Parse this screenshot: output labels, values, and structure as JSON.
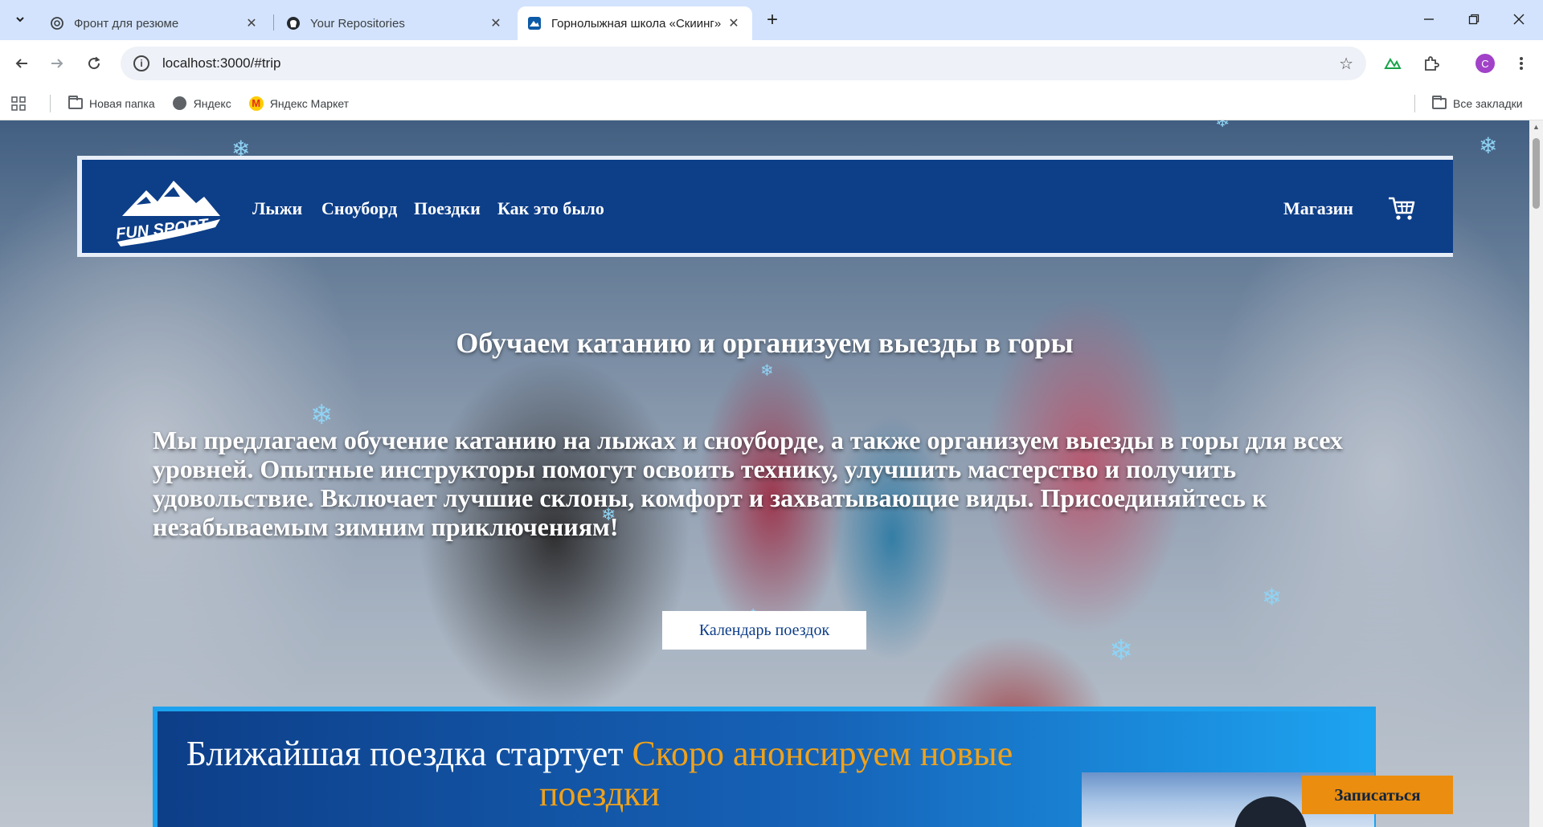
{
  "browser": {
    "tabs": [
      {
        "title": "Фронт для резюме",
        "icon": "openai-icon",
        "active": false
      },
      {
        "title": "Your Repositories",
        "icon": "github-icon",
        "active": false
      },
      {
        "title": "Горнолыжная школа «Скиинг»",
        "icon": "site-favicon",
        "active": true
      }
    ],
    "url": "localhost:3000/#trip",
    "profile_initial": "C",
    "bookmarks": [
      {
        "label": "Новая папка",
        "icon": "folder-icon"
      },
      {
        "label": "Яндекс",
        "icon": "globe-icon"
      },
      {
        "label": "Яндекс Маркет",
        "icon": "yandex-market-icon"
      }
    ],
    "all_bookmarks": "Все закладки"
  },
  "site": {
    "nav": {
      "logo_text": "FUN SPORT",
      "links": [
        "Лыжи",
        "Сноуборд",
        "Поездки",
        "Как это было"
      ],
      "shop": "Магазин"
    },
    "hero": {
      "title": "Обучаем катанию и организуем выезды в горы",
      "text": "Мы предлагаем обучение катанию на лыжах и сноуборде, а также организуем выезды в горы для всех уровней. Опытные инструкторы помогут освоить технику, улучшить мастерство и получить удовольствие. Включает лучшие склоны, комфорт и захватывающие виды. Присоединяйтесь к незабываемым зимним приключениям!",
      "calendar_button": "Календарь поездок"
    },
    "trip": {
      "heading_prefix": "Ближайшая поездка стартует",
      "heading_highlight": "Скоро анонсируем новые поездки",
      "signup_button": "Записаться"
    },
    "colors": {
      "nav_bg": "#0d3e88",
      "accent_orange": "#eb8d0e",
      "accent_blue": "#1ca2ef"
    }
  }
}
